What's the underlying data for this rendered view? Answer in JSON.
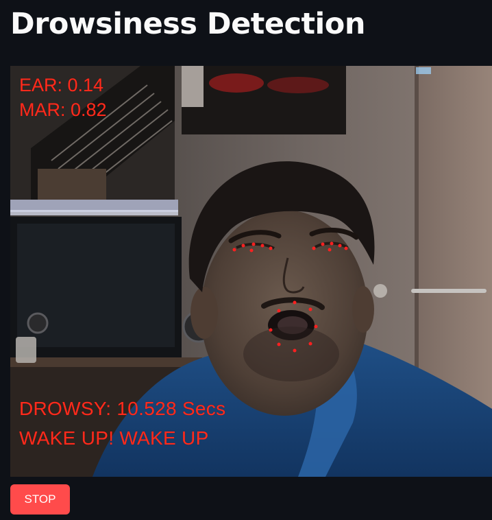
{
  "page": {
    "title": "Drowsiness Detection"
  },
  "video_feed": {
    "ear_text": "EAR: 0.14",
    "mar_text": "MAR: 0.82",
    "drowsy_text": "DROWSY: 10.528 Secs",
    "alert_text": "WAKE UP! WAKE UP"
  },
  "controls": {
    "stop_label": "STOP"
  },
  "colors": {
    "background": "#0e1117",
    "title_text": "#fafafa",
    "overlay_text": "#ff2b1c",
    "stop_button": "#ff4b4b",
    "landmark_dots": "#ff2020"
  }
}
